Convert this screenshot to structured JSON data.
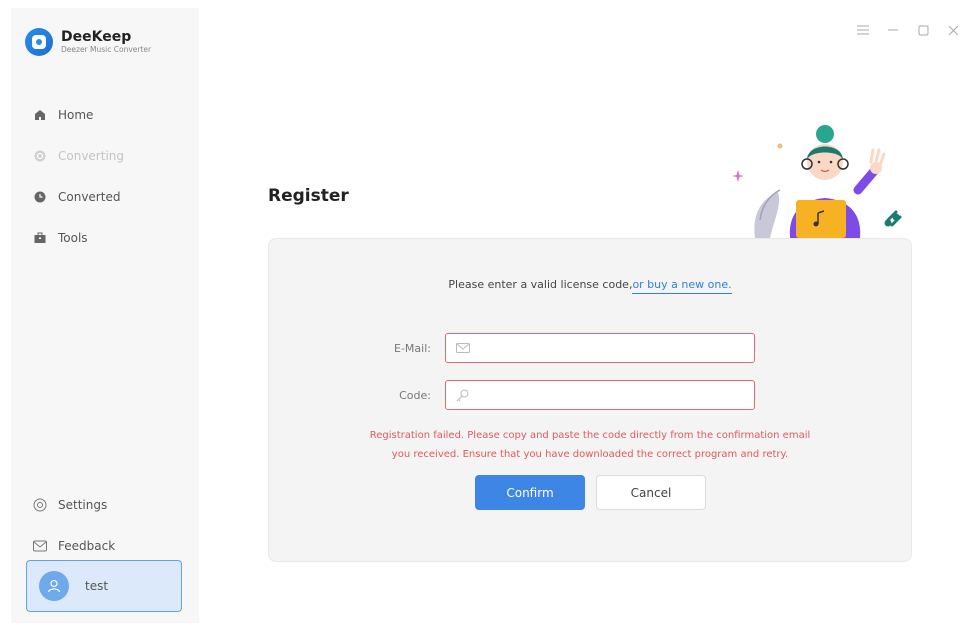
{
  "brand": {
    "name": "DeeKeep",
    "subtitle": "Deezer Music Converter"
  },
  "nav": [
    {
      "label": "Home",
      "icon": "home-icon"
    },
    {
      "label": "Converting",
      "icon": "converting-icon",
      "disabled": true
    },
    {
      "label": "Converted",
      "icon": "clock-icon"
    },
    {
      "label": "Tools",
      "icon": "toolbox-icon"
    }
  ],
  "bottom_nav": [
    {
      "label": "Settings",
      "icon": "settings-icon"
    },
    {
      "label": "Feedback",
      "icon": "mail-icon"
    }
  ],
  "user": {
    "name": "test"
  },
  "main": {
    "title": "Register",
    "prompt_text": "Please enter a valid license code,",
    "prompt_link": "or buy a new one.",
    "email_label": "E-Mail:",
    "email_value": "",
    "code_label": "Code:",
    "code_value": "",
    "error_line1": "Registration failed. Please copy and paste the code directly from the confirmation email",
    "error_line2": "you received. Ensure that you have downloaded the correct program and retry.",
    "confirm_label": "Confirm",
    "cancel_label": "Cancel"
  },
  "colors": {
    "accent": "#3d86e6",
    "error": "#e05a5a",
    "sidebar_bg": "#f7f7f8",
    "card_bg": "#f4f4f5"
  }
}
